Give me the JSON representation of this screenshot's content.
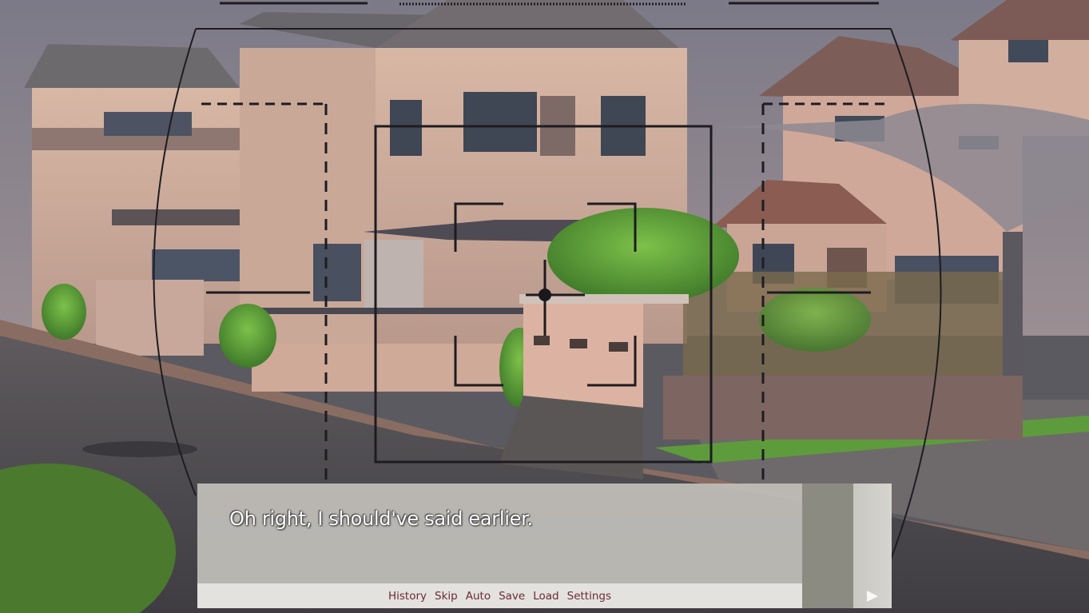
{
  "dialogue": {
    "text": "Oh right, I should've said earlier."
  },
  "menu": {
    "history": "History",
    "skip": "Skip",
    "auto": "Auto",
    "save": "Save",
    "load": "Load",
    "settings": "Settings"
  },
  "icons": {
    "advance": "play-triangle-icon",
    "viewfinder": "camera-viewfinder-overlay",
    "focus_point": "focus-dot-icon"
  },
  "colors": {
    "menu_text": "#6a2a39",
    "textbox": "#bfbdb7",
    "menubar": "#e4e2de",
    "sidebar": "#8c8b81"
  }
}
